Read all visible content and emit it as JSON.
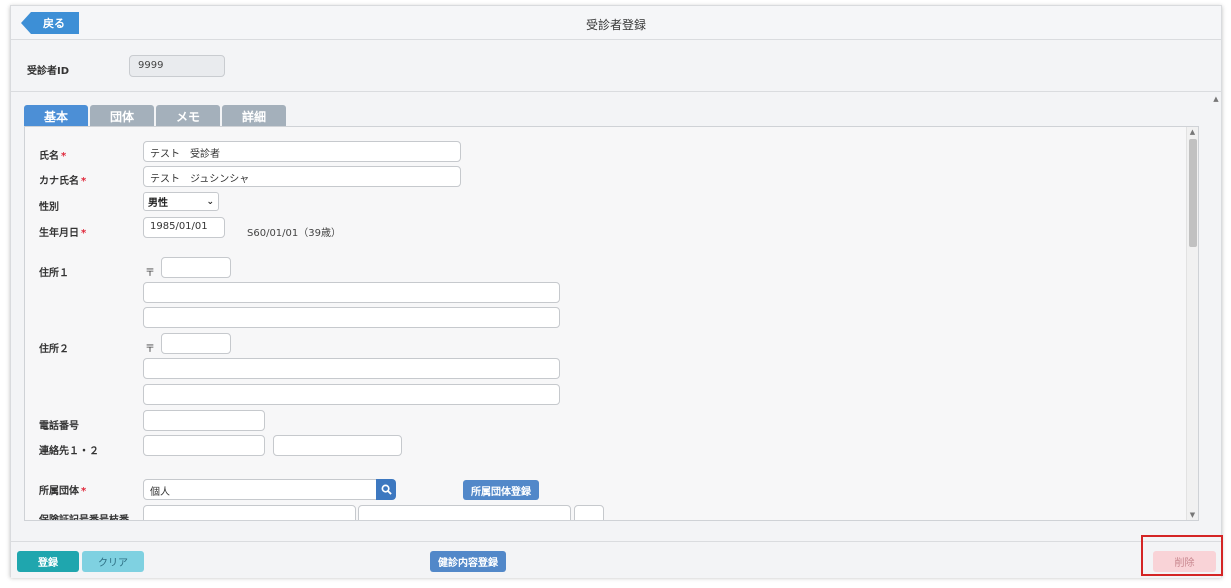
{
  "header": {
    "back_label": "戻る",
    "title": "受診者登録"
  },
  "id_row": {
    "label": "受診者ID",
    "value": "9999"
  },
  "tabs": [
    {
      "label": "基本",
      "active": true
    },
    {
      "label": "団体",
      "active": false
    },
    {
      "label": "メモ",
      "active": false
    },
    {
      "label": "詳細",
      "active": false
    }
  ],
  "form": {
    "required_mark": "*",
    "name": {
      "label": "氏名",
      "value": "テスト　受診者"
    },
    "kana": {
      "label": "カナ氏名",
      "value": "テスト　ジュシンシャ"
    },
    "gender": {
      "label": "性別",
      "selected": "男性"
    },
    "birthdate": {
      "label": "生年月日",
      "value": "1985/01/01",
      "wareki": "S60/01/01（39歳）"
    },
    "address1": {
      "label": "住所１",
      "zip_mark": "〒"
    },
    "address2": {
      "label": "住所２",
      "zip_mark": "〒"
    },
    "phone": {
      "label": "電話番号"
    },
    "contact": {
      "label": "連絡先１・２"
    },
    "group": {
      "label": "所属団体",
      "value": "個人",
      "register_label": "所属団体登録"
    },
    "insurance": {
      "label": "保険証記号番号枝番"
    }
  },
  "footer": {
    "register_label": "登録",
    "clear_label": "クリア",
    "exam_register_label": "健診内容登録",
    "delete_label": "削除"
  },
  "colors": {
    "primary": "#4c8fd6",
    "teal": "#1fa6ae",
    "required": "#e0273a",
    "highlight": "#d42525"
  }
}
